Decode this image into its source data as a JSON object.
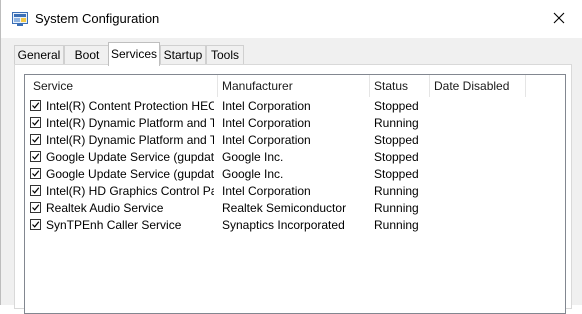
{
  "window": {
    "title": "System Configuration",
    "icon": "system-config-icon",
    "close_icon": "close-icon"
  },
  "tabs": [
    {
      "label": "General",
      "active": false
    },
    {
      "label": "Boot",
      "active": false
    },
    {
      "label": "Services",
      "active": true
    },
    {
      "label": "Startup",
      "active": false
    },
    {
      "label": "Tools",
      "active": false
    }
  ],
  "services": {
    "columns": [
      "Service",
      "Manufacturer",
      "Status",
      "Date Disabled"
    ],
    "rows": [
      {
        "checked": true,
        "service": "Intel(R) Content Protection HEC...",
        "manufacturer": "Intel Corporation",
        "status": "Stopped",
        "date_disabled": ""
      },
      {
        "checked": true,
        "service": "Intel(R) Dynamic Platform and T...",
        "manufacturer": "Intel Corporation",
        "status": "Running",
        "date_disabled": ""
      },
      {
        "checked": true,
        "service": "Intel(R) Dynamic Platform and T...",
        "manufacturer": "Intel Corporation",
        "status": "Stopped",
        "date_disabled": ""
      },
      {
        "checked": true,
        "service": "Google Update Service (gupdate)",
        "manufacturer": "Google Inc.",
        "status": "Stopped",
        "date_disabled": ""
      },
      {
        "checked": true,
        "service": "Google Update Service (gupdatem)",
        "manufacturer": "Google Inc.",
        "status": "Stopped",
        "date_disabled": ""
      },
      {
        "checked": true,
        "service": "Intel(R) HD Graphics Control Pa...",
        "manufacturer": "Intel Corporation",
        "status": "Running",
        "date_disabled": ""
      },
      {
        "checked": true,
        "service": "Realtek Audio Service",
        "manufacturer": "Realtek Semiconductor",
        "status": "Running",
        "date_disabled": ""
      },
      {
        "checked": true,
        "service": "SynTPEnh Caller Service",
        "manufacturer": "Synaptics Incorporated",
        "status": "Running",
        "date_disabled": ""
      }
    ]
  }
}
